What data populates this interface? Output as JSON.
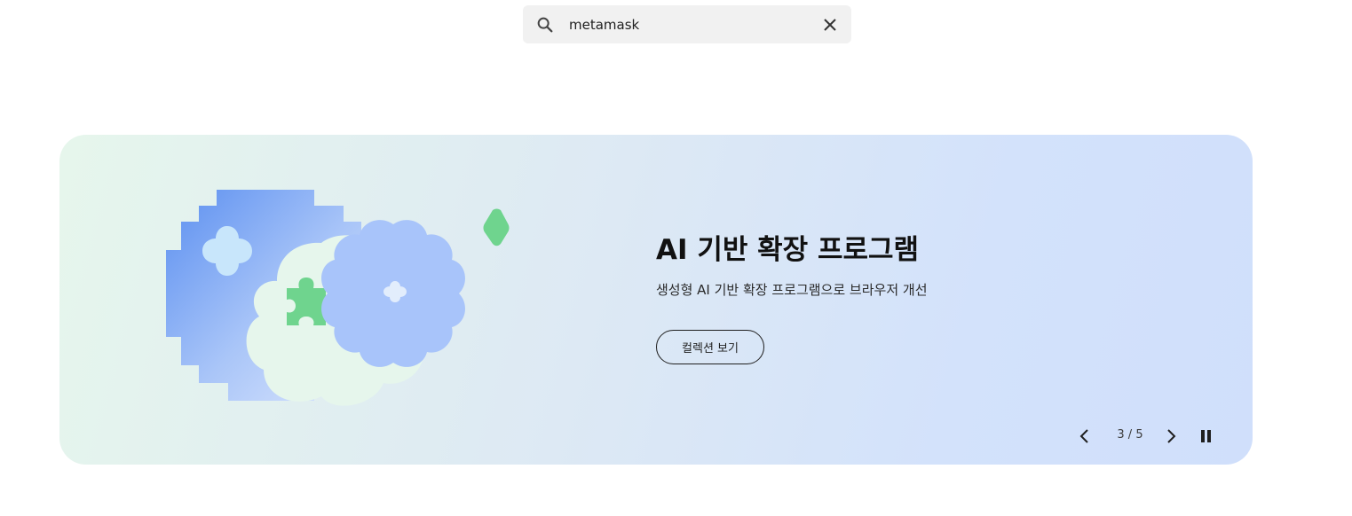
{
  "search": {
    "value": "metamask",
    "placeholder": ""
  },
  "banner": {
    "title": "AI 기반 확장 프로그램",
    "subtitle": "생성형 AI 기반 확장 프로그램으로 브라우저 개선",
    "button_label": "컬렉션 보기",
    "illustration_icons": [
      "pixel-blob-icon",
      "cloud-shape-icon",
      "puzzle-piece-icon",
      "flower-shape-icon",
      "diamond-icon"
    ]
  },
  "carousel": {
    "current": 3,
    "total": 5,
    "indicator": "3 / 5",
    "prev_icon": "chevron-left-icon",
    "next_icon": "chevron-right-icon",
    "pause_icon": "pause-icon"
  },
  "colors": {
    "search_bg": "#f1f1f1",
    "banner_gradient_start": "#e6f6ec",
    "banner_gradient_end": "#d0dffb",
    "accent_blue": "#a8c4fa",
    "accent_green": "#6fd48e"
  }
}
